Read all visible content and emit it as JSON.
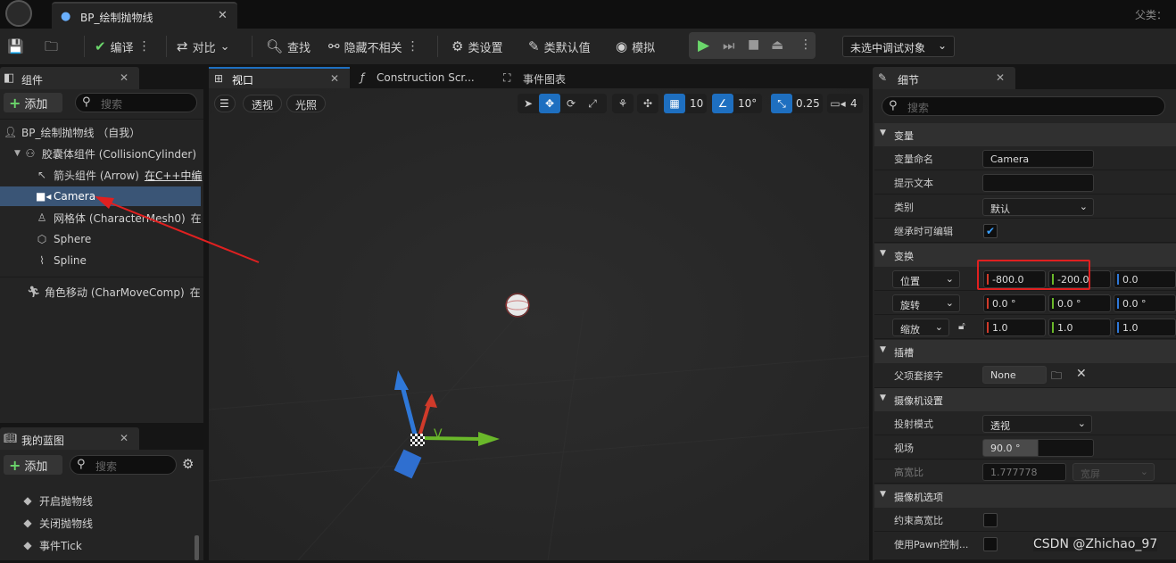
{
  "window": {
    "tab_title": "BP_绘制抛物线",
    "parent_label": "父类："
  },
  "toolbar": {
    "compile": "编译",
    "diff": "对比",
    "find": "查找",
    "hide_unrelated": "隐藏不相关",
    "class_settings": "类设置",
    "class_defaults": "类默认值",
    "simulate": "模拟",
    "debug_target": "未选中调试对象"
  },
  "components": {
    "title": "组件",
    "add": "添加",
    "search_placeholder": "搜索",
    "items": [
      {
        "label": "BP_绘制抛物线 （自我）",
        "icon": "user-icon"
      },
      {
        "label": "胶囊体组件 (CollisionCylinder)",
        "icon": "capsule-icon"
      },
      {
        "label": "箭头组件 (Arrow)",
        "extra": "在C++中编",
        "icon": "arrow-icon"
      },
      {
        "label": "Camera",
        "icon": "camera-icon"
      },
      {
        "label": "网格体 (CharacterMesh0)",
        "extra": "在",
        "icon": "mesh-icon"
      },
      {
        "label": "Sphere",
        "icon": "sphere-icon"
      },
      {
        "label": "Spline",
        "icon": "spline-icon"
      },
      {
        "label": "角色移动 (CharMoveComp)",
        "extra": "在",
        "icon": "movement-icon"
      }
    ]
  },
  "my_blueprint": {
    "title": "我的蓝图",
    "add": "添加",
    "search_placeholder": "搜索",
    "items": [
      "开启抛物线",
      "关闭抛物线",
      "事件Tick"
    ]
  },
  "tabs": {
    "viewport": "视口",
    "construction": "Construction Scr...",
    "event_graph": "事件图表"
  },
  "viewport": {
    "perspective": "透视",
    "lighting": "光照",
    "grid_size": "10",
    "rotation_snap": "10°",
    "scale_snap": "0.25",
    "camera_speed": "4"
  },
  "details": {
    "title": "细节",
    "search_placeholder": "搜索",
    "sections": {
      "variable": "变量",
      "transform": "变换",
      "sockets": "插槽",
      "camera_settings": "摄像机设置",
      "camera_options": "摄像机选项"
    },
    "fields": {
      "var_name_label": "变量命名",
      "var_name_value": "Camera",
      "tooltip_label": "提示文本",
      "tooltip_value": "",
      "category_label": "类别",
      "category_value": "默认",
      "editable_label": "继承时可编辑",
      "editable_checked": true,
      "location_label": "位置",
      "location": [
        "-800.0",
        "-200.0",
        "0.0"
      ],
      "rotation_label": "旋转",
      "rotation": [
        "0.0 °",
        "0.0 °",
        "0.0 °"
      ],
      "scale_label": "缩放",
      "scale": [
        "1.0",
        "1.0",
        "1.0"
      ],
      "parent_socket_label": "父项套接字",
      "parent_socket_value": "None",
      "projection_label": "投射模式",
      "projection_value": "透视",
      "fov_label": "视场",
      "fov_value": "90.0 °",
      "aspect_label": "高宽比",
      "aspect_value": "1.777778",
      "aspect_preset": "宽屏",
      "constrain_label": "约束高宽比",
      "pawn_control_label": "使用Pawn控制..."
    }
  },
  "watermark": "CSDN @Zhichao_97",
  "colors": {
    "accent": "#1e6fc0",
    "selection": "#3a5576",
    "highlight_box": "#e02020",
    "x_axis": "#d03a2a",
    "y_axis": "#6ab82a",
    "z_axis": "#2f78d8"
  }
}
